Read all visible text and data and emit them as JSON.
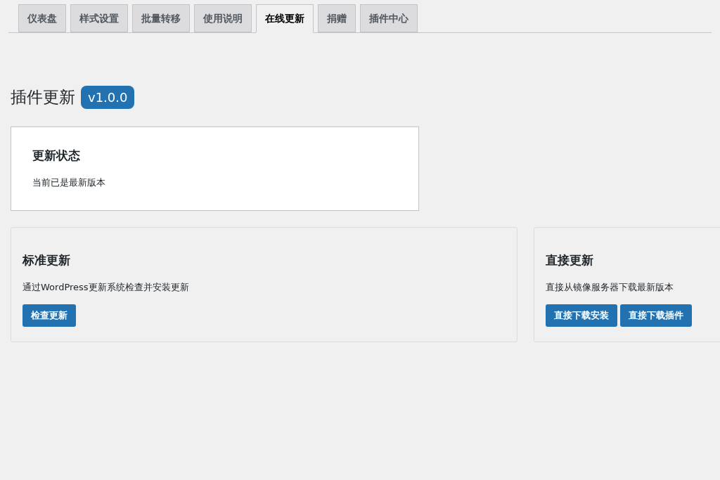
{
  "tabs": [
    {
      "label": "仪表盘",
      "selected": false
    },
    {
      "label": "样式设置",
      "selected": false
    },
    {
      "label": "批量转移",
      "selected": false
    },
    {
      "label": "使用说明",
      "selected": false
    },
    {
      "label": "在线更新",
      "selected": true
    },
    {
      "label": "捐赠",
      "selected": false
    },
    {
      "label": "插件中心",
      "selected": false
    }
  ],
  "heading": {
    "title": "插件更新",
    "version": "v1.0.0"
  },
  "status_card": {
    "title": "更新状态",
    "text": "当前已是最新版本"
  },
  "update_cards": [
    {
      "title": "标准更新",
      "text": "通过WordPress更新系统检查并安装更新",
      "buttons": [
        "检查更新"
      ]
    },
    {
      "title": "直接更新",
      "text": "直接从镜像服务器下载最新版本",
      "buttons": [
        "直接下载安装",
        "直接下载插件"
      ]
    }
  ]
}
